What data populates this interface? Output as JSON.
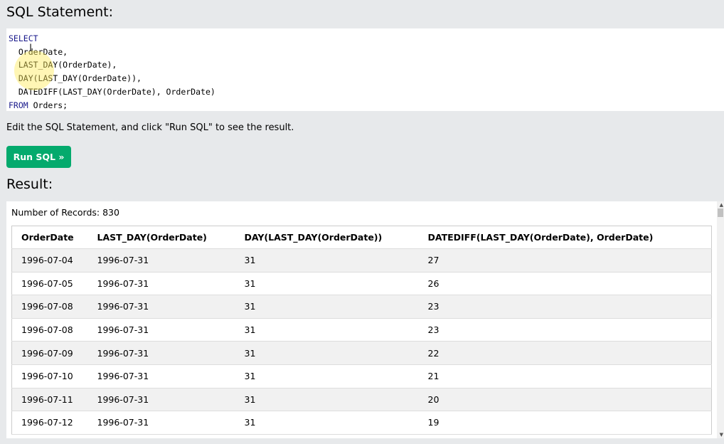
{
  "sql_heading": "SQL Statement:",
  "code_lines": [
    {
      "kw": "SELECT",
      "rest": ""
    },
    {
      "kw": "",
      "rest": "  OrderDate,"
    },
    {
      "kw": "",
      "rest": "  LAST_DAY(OrderDate),"
    },
    {
      "kw": "",
      "rest": "  DAY(LAST_DAY(OrderDate)),"
    },
    {
      "kw": "",
      "rest": "  DATEDIFF(LAST_DAY(OrderDate), OrderDate)"
    },
    {
      "kw": "FROM",
      "rest": " Orders;"
    }
  ],
  "hint": "Edit the SQL Statement, and click \"Run SQL\" to see the result.",
  "run_button": "Run SQL »",
  "result_heading": "Result:",
  "records": "Number of Records: 830",
  "table": {
    "headers": [
      "OrderDate",
      "LAST_DAY(OrderDate)",
      "DAY(LAST_DAY(OrderDate))",
      "DATEDIFF(LAST_DAY(OrderDate), OrderDate)"
    ],
    "rows": [
      [
        "1996-07-04",
        "1996-07-31",
        "31",
        "27"
      ],
      [
        "1996-07-05",
        "1996-07-31",
        "31",
        "26"
      ],
      [
        "1996-07-08",
        "1996-07-31",
        "31",
        "23"
      ],
      [
        "1996-07-08",
        "1996-07-31",
        "31",
        "23"
      ],
      [
        "1996-07-09",
        "1996-07-31",
        "31",
        "22"
      ],
      [
        "1996-07-10",
        "1996-07-31",
        "31",
        "21"
      ],
      [
        "1996-07-11",
        "1996-07-31",
        "31",
        "20"
      ],
      [
        "1996-07-12",
        "1996-07-31",
        "31",
        "19"
      ]
    ]
  },
  "colors": {
    "button": "#04aa6d",
    "keyword": "#19198b",
    "page_bg": "#e7e9eb"
  }
}
